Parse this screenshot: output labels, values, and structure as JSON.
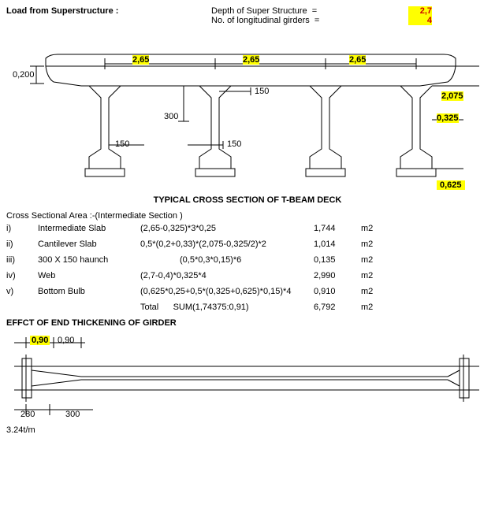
{
  "header": {
    "title": "Load from Superstructure :",
    "labels": {
      "depth": "Depth of Super Structure",
      "girders": "No. of longitudinal girders"
    },
    "values": {
      "depth": "2,7",
      "girders": "4"
    }
  },
  "cross_section": {
    "title": "TYPICAL  CROSS SECTION OF T-BEAM DECK",
    "dims": {
      "span1": "2,65",
      "span2": "2,65",
      "span3": "2,65",
      "left_edge": "0,200",
      "h300": "300",
      "h150a": "150",
      "h150b": "150",
      "h150c": "150",
      "right1": "2,075",
      "right2": "0,325",
      "right3": "0,625"
    }
  },
  "calcs": {
    "title": "Cross Sectional Area :-(Intermediate Section )",
    "rows": [
      {
        "i": "i)",
        "name": "Intermediate Slab",
        "form": "(2,65-0,325)*3*0,25",
        "val": "1,744",
        "unit": "m2"
      },
      {
        "i": "ii)",
        "name": "Cantilever Slab",
        "form": "0,5*(0,2+0,33)*(2,075-0,325/2)*2",
        "val": "1,014",
        "unit": "m2"
      },
      {
        "i": "iii)",
        "name": "300 X 150 haunch",
        "form": "(0,5*0,3*0,15)*6",
        "val": "0,135",
        "unit": "m2"
      },
      {
        "i": "iv)",
        "name": "Web",
        "form": "(2,7-0,4)*0,325*4",
        "val": "2,990",
        "unit": "m2"
      },
      {
        "i": "v)",
        "name": "Bottom Bulb",
        "form": "(0,625*0,25+0,5*(0,325+0,625)*0,15)*4",
        "val": "0,910",
        "unit": "m2"
      }
    ],
    "total": {
      "label": "Total",
      "form": "SUM(1,74375:0,91)",
      "val": "6,792",
      "unit": "m2"
    }
  },
  "effect": {
    "title": "EFFCT OF END THICKENING OF GIRDER",
    "dims": {
      "d090a": "0,90",
      "d090b": "0,90",
      "d280": "280",
      "d300": "300"
    },
    "load": "3.24t/m"
  }
}
